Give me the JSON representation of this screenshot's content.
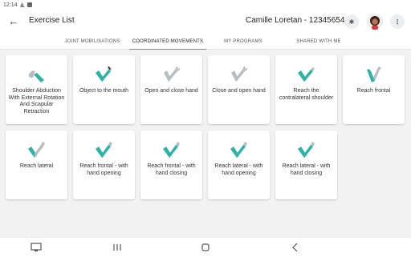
{
  "status_bar": {
    "time": "12:14"
  },
  "app_bar": {
    "title": "Exercise List",
    "user": "Camille Loretan - 12345654",
    "more_label": "⋮",
    "bluetooth_label": "✱"
  },
  "tabs": [
    {
      "label": "JOINT MOBILISATIONS",
      "active": false
    },
    {
      "label": "COORDINATED MOVEMENTS",
      "active": true
    },
    {
      "label": "MY PROGRAMS",
      "active": false
    },
    {
      "label": "SHARED WITH ME",
      "active": false
    }
  ],
  "exercises": [
    {
      "label": "Shoulder Abduction With External Rotation And Scapular Retraction",
      "icon": "arm-abduction-icon"
    },
    {
      "label": "Object to the mouth",
      "icon": "arm-object-mouth-icon"
    },
    {
      "label": "Open and close hand",
      "icon": "hand-open-close-icon"
    },
    {
      "label": "Close and open hand",
      "icon": "hand-close-open-icon"
    },
    {
      "label": "Reach the contralateral shoulder",
      "icon": "arm-contralateral-icon"
    },
    {
      "label": "Reach frontal",
      "icon": "arm-reach-frontal-icon"
    },
    {
      "label": "Reach lateral",
      "icon": "arm-reach-lateral-icon"
    },
    {
      "label": "Reach frontal - with hand opening",
      "icon": "arm-reach-frontal-open-icon"
    },
    {
      "label": "Reach frontal - with hand closing",
      "icon": "arm-reach-frontal-close-icon"
    },
    {
      "label": "Reach lateral - with hand opening",
      "icon": "arm-reach-lateral-open-icon"
    },
    {
      "label": "Reach lateral - with hand closing",
      "icon": "arm-reach-lateral-close-icon"
    }
  ],
  "colors": {
    "accent": "#2ab3a6",
    "hand_gray": "#b9bcc0",
    "background": "#f2f2f3"
  }
}
